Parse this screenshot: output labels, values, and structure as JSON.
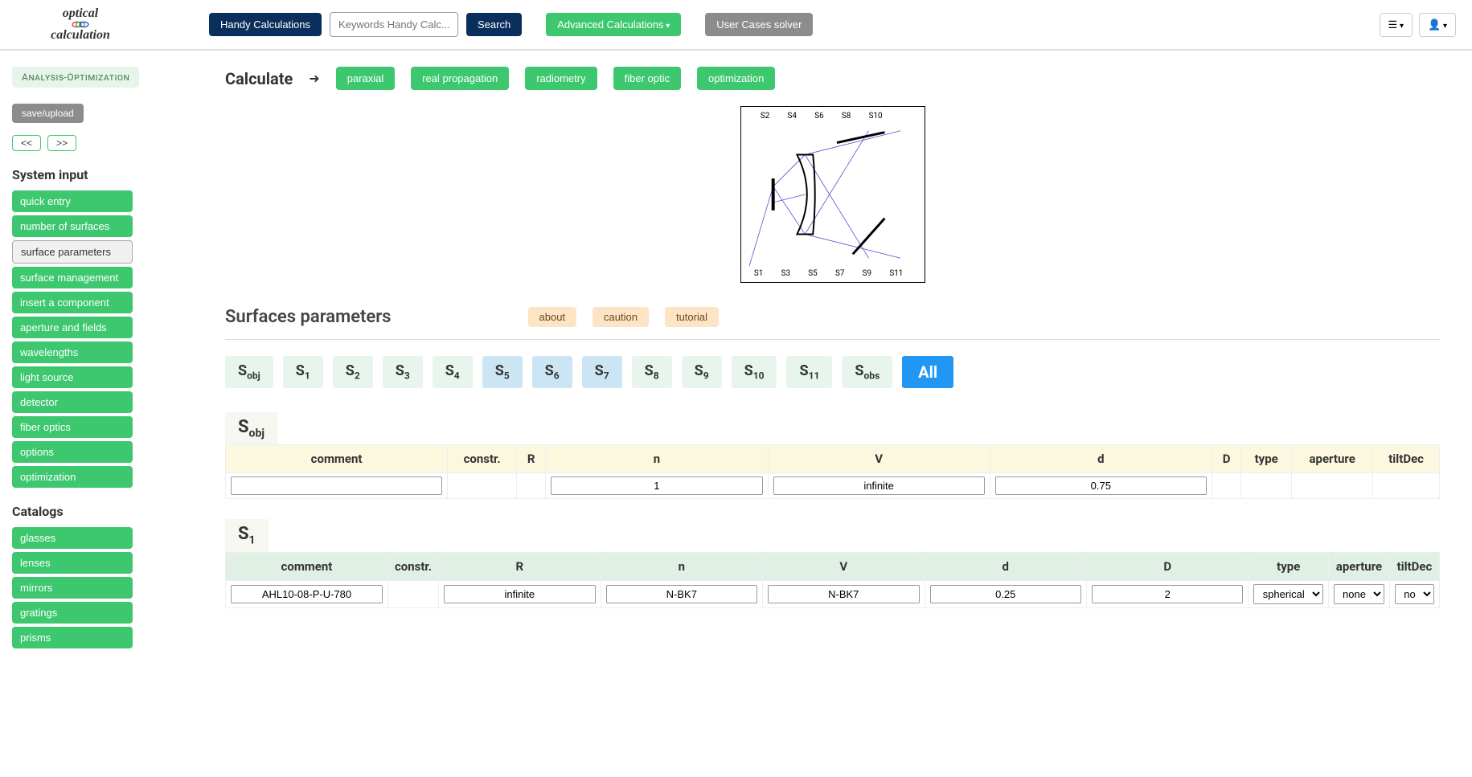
{
  "header": {
    "logo_top": "optical",
    "logo_bottom": "calculation",
    "handy_calc": "Handy Calculations",
    "search_placeholder": "Keywords Handy Calc...",
    "search_btn": "Search",
    "advanced_calc": "Advanced Calculations",
    "user_cases": "User Cases solver"
  },
  "sidebar": {
    "badge": "Analysis-Optimization",
    "save_upload": "save/upload",
    "prev": "<<",
    "next": ">>",
    "system_input_title": "System input",
    "system_input_items": [
      "quick entry",
      "number of surfaces",
      "surface parameters",
      "surface management",
      "insert a component",
      "aperture and fields",
      "wavelengths",
      "light source",
      "detector",
      "fiber optics",
      "options",
      "optimization"
    ],
    "system_input_active_index": 2,
    "catalogs_title": "Catalogs",
    "catalogs_items": [
      "glasses",
      "lenses",
      "mirrors",
      "gratings",
      "prisms"
    ]
  },
  "calculate": {
    "label": "Calculate",
    "buttons": [
      "paraxial",
      "real propagation",
      "radiometry",
      "fiber optic",
      "optimization"
    ]
  },
  "diagram": {
    "top_labels": [
      "S2",
      "S4",
      "S6",
      "S8",
      "S10"
    ],
    "bottom_labels": [
      "S1",
      "S3",
      "S5",
      "S7",
      "S9",
      "S11"
    ]
  },
  "surfaces_header": {
    "title": "Surfaces parameters",
    "about": "about",
    "caution": "caution",
    "tutorial": "tutorial"
  },
  "surface_tabs": [
    {
      "label": "S",
      "sub": "obj",
      "class": "green"
    },
    {
      "label": "S",
      "sub": "1",
      "class": "green"
    },
    {
      "label": "S",
      "sub": "2",
      "class": "green"
    },
    {
      "label": "S",
      "sub": "3",
      "class": "green"
    },
    {
      "label": "S",
      "sub": "4",
      "class": "green"
    },
    {
      "label": "S",
      "sub": "5",
      "class": "blue"
    },
    {
      "label": "S",
      "sub": "6",
      "class": "blue"
    },
    {
      "label": "S",
      "sub": "7",
      "class": "blue"
    },
    {
      "label": "S",
      "sub": "8",
      "class": "green"
    },
    {
      "label": "S",
      "sub": "9",
      "class": "green"
    },
    {
      "label": "S",
      "sub": "10",
      "class": "green"
    },
    {
      "label": "S",
      "sub": "11",
      "class": "green"
    },
    {
      "label": "S",
      "sub": "obs",
      "class": "green"
    }
  ],
  "all_tab": "All",
  "columns": [
    "comment",
    "constr.",
    "R",
    "n",
    "V",
    "d",
    "D",
    "type",
    "aperture",
    "tiltDec"
  ],
  "s_obj": {
    "label_main": "S",
    "label_sub": "obj",
    "row": {
      "comment": "",
      "constr": "",
      "R": "",
      "n": "1",
      "V": "infinite",
      "d": "0.75",
      "D": "",
      "type": "",
      "aperture": "",
      "tiltDec": ""
    }
  },
  "s_1": {
    "label_main": "S",
    "label_sub": "1",
    "row": {
      "comment": "AHL10-08-P-U-780",
      "constr": "",
      "R": "infinite",
      "n": "N-BK7",
      "V": "N-BK7",
      "d": "0.25",
      "D": "2",
      "type": "spherical",
      "aperture": "none",
      "tiltDec": "no"
    }
  }
}
